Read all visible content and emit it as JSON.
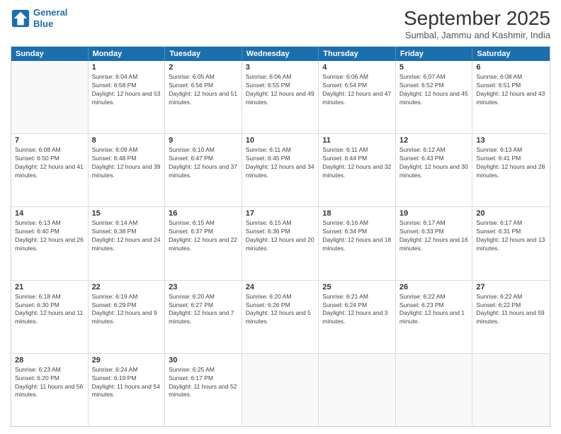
{
  "logo": {
    "line1": "General",
    "line2": "Blue"
  },
  "title": "September 2025",
  "subtitle": "Sumbal, Jammu and Kashmir, India",
  "header_days": [
    "Sunday",
    "Monday",
    "Tuesday",
    "Wednesday",
    "Thursday",
    "Friday",
    "Saturday"
  ],
  "rows": [
    [
      {
        "day": "",
        "sunrise": "",
        "sunset": "",
        "daylight": ""
      },
      {
        "day": "1",
        "sunrise": "Sunrise: 6:04 AM",
        "sunset": "Sunset: 6:58 PM",
        "daylight": "Daylight: 12 hours and 53 minutes."
      },
      {
        "day": "2",
        "sunrise": "Sunrise: 6:05 AM",
        "sunset": "Sunset: 6:56 PM",
        "daylight": "Daylight: 12 hours and 51 minutes."
      },
      {
        "day": "3",
        "sunrise": "Sunrise: 6:06 AM",
        "sunset": "Sunset: 6:55 PM",
        "daylight": "Daylight: 12 hours and 49 minutes."
      },
      {
        "day": "4",
        "sunrise": "Sunrise: 6:06 AM",
        "sunset": "Sunset: 6:54 PM",
        "daylight": "Daylight: 12 hours and 47 minutes."
      },
      {
        "day": "5",
        "sunrise": "Sunrise: 6:07 AM",
        "sunset": "Sunset: 6:52 PM",
        "daylight": "Daylight: 12 hours and 45 minutes."
      },
      {
        "day": "6",
        "sunrise": "Sunrise: 6:08 AM",
        "sunset": "Sunset: 6:51 PM",
        "daylight": "Daylight: 12 hours and 43 minutes."
      }
    ],
    [
      {
        "day": "7",
        "sunrise": "Sunrise: 6:08 AM",
        "sunset": "Sunset: 6:50 PM",
        "daylight": "Daylight: 12 hours and 41 minutes."
      },
      {
        "day": "8",
        "sunrise": "Sunrise: 6:09 AM",
        "sunset": "Sunset: 6:48 PM",
        "daylight": "Daylight: 12 hours and 39 minutes."
      },
      {
        "day": "9",
        "sunrise": "Sunrise: 6:10 AM",
        "sunset": "Sunset: 6:47 PM",
        "daylight": "Daylight: 12 hours and 37 minutes."
      },
      {
        "day": "10",
        "sunrise": "Sunrise: 6:11 AM",
        "sunset": "Sunset: 6:45 PM",
        "daylight": "Daylight: 12 hours and 34 minutes."
      },
      {
        "day": "11",
        "sunrise": "Sunrise: 6:11 AM",
        "sunset": "Sunset: 6:44 PM",
        "daylight": "Daylight: 12 hours and 32 minutes."
      },
      {
        "day": "12",
        "sunrise": "Sunrise: 6:12 AM",
        "sunset": "Sunset: 6:43 PM",
        "daylight": "Daylight: 12 hours and 30 minutes."
      },
      {
        "day": "13",
        "sunrise": "Sunrise: 6:13 AM",
        "sunset": "Sunset: 6:41 PM",
        "daylight": "Daylight: 12 hours and 28 minutes."
      }
    ],
    [
      {
        "day": "14",
        "sunrise": "Sunrise: 6:13 AM",
        "sunset": "Sunset: 6:40 PM",
        "daylight": "Daylight: 12 hours and 26 minutes."
      },
      {
        "day": "15",
        "sunrise": "Sunrise: 6:14 AM",
        "sunset": "Sunset: 6:38 PM",
        "daylight": "Daylight: 12 hours and 24 minutes."
      },
      {
        "day": "16",
        "sunrise": "Sunrise: 6:15 AM",
        "sunset": "Sunset: 6:37 PM",
        "daylight": "Daylight: 12 hours and 22 minutes."
      },
      {
        "day": "17",
        "sunrise": "Sunrise: 6:15 AM",
        "sunset": "Sunset: 6:36 PM",
        "daylight": "Daylight: 12 hours and 20 minutes."
      },
      {
        "day": "18",
        "sunrise": "Sunrise: 6:16 AM",
        "sunset": "Sunset: 6:34 PM",
        "daylight": "Daylight: 12 hours and 18 minutes."
      },
      {
        "day": "19",
        "sunrise": "Sunrise: 6:17 AM",
        "sunset": "Sunset: 6:33 PM",
        "daylight": "Daylight: 12 hours and 16 minutes."
      },
      {
        "day": "20",
        "sunrise": "Sunrise: 6:17 AM",
        "sunset": "Sunset: 6:31 PM",
        "daylight": "Daylight: 12 hours and 13 minutes."
      }
    ],
    [
      {
        "day": "21",
        "sunrise": "Sunrise: 6:18 AM",
        "sunset": "Sunset: 6:30 PM",
        "daylight": "Daylight: 12 hours and 11 minutes."
      },
      {
        "day": "22",
        "sunrise": "Sunrise: 6:19 AM",
        "sunset": "Sunset: 6:29 PM",
        "daylight": "Daylight: 12 hours and 9 minutes."
      },
      {
        "day": "23",
        "sunrise": "Sunrise: 6:20 AM",
        "sunset": "Sunset: 6:27 PM",
        "daylight": "Daylight: 12 hours and 7 minutes."
      },
      {
        "day": "24",
        "sunrise": "Sunrise: 6:20 AM",
        "sunset": "Sunset: 6:26 PM",
        "daylight": "Daylight: 12 hours and 5 minutes."
      },
      {
        "day": "25",
        "sunrise": "Sunrise: 6:21 AM",
        "sunset": "Sunset: 6:24 PM",
        "daylight": "Daylight: 12 hours and 3 minutes."
      },
      {
        "day": "26",
        "sunrise": "Sunrise: 6:22 AM",
        "sunset": "Sunset: 6:23 PM",
        "daylight": "Daylight: 12 hours and 1 minute."
      },
      {
        "day": "27",
        "sunrise": "Sunrise: 6:22 AM",
        "sunset": "Sunset: 6:22 PM",
        "daylight": "Daylight: 11 hours and 59 minutes."
      }
    ],
    [
      {
        "day": "28",
        "sunrise": "Sunrise: 6:23 AM",
        "sunset": "Sunset: 6:20 PM",
        "daylight": "Daylight: 11 hours and 56 minutes."
      },
      {
        "day": "29",
        "sunrise": "Sunrise: 6:24 AM",
        "sunset": "Sunset: 6:19 PM",
        "daylight": "Daylight: 11 hours and 54 minutes."
      },
      {
        "day": "30",
        "sunrise": "Sunrise: 6:25 AM",
        "sunset": "Sunset: 6:17 PM",
        "daylight": "Daylight: 11 hours and 52 minutes."
      },
      {
        "day": "",
        "sunrise": "",
        "sunset": "",
        "daylight": ""
      },
      {
        "day": "",
        "sunrise": "",
        "sunset": "",
        "daylight": ""
      },
      {
        "day": "",
        "sunrise": "",
        "sunset": "",
        "daylight": ""
      },
      {
        "day": "",
        "sunrise": "",
        "sunset": "",
        "daylight": ""
      }
    ]
  ]
}
